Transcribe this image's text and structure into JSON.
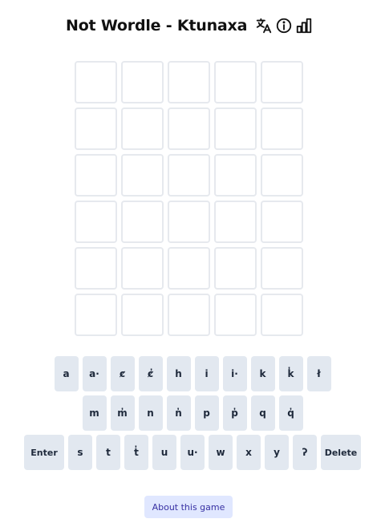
{
  "header": {
    "title": "Not Wordle - Ktunaxa",
    "icons": [
      "translate-icon",
      "info-icon",
      "stats-icon"
    ]
  },
  "board": {
    "rows": 6,
    "columns": 5,
    "letters": [
      [
        "",
        "",
        "",
        "",
        ""
      ],
      [
        "",
        "",
        "",
        "",
        ""
      ],
      [
        "",
        "",
        "",
        "",
        ""
      ],
      [
        "",
        "",
        "",
        "",
        ""
      ],
      [
        "",
        "",
        "",
        "",
        ""
      ],
      [
        "",
        "",
        "",
        "",
        ""
      ]
    ]
  },
  "keyboard": {
    "row1": [
      "a",
      "a·",
      "ȼ",
      "ȼ̓",
      "h",
      "i",
      "i·",
      "k",
      "k̓",
      "ł"
    ],
    "row2": [
      "m",
      "m̓",
      "n",
      "n̓",
      "p",
      "p̓",
      "q",
      "q̓"
    ],
    "row3": [
      "Enter",
      "s",
      "t",
      "t̓",
      "u",
      "u·",
      "w",
      "x",
      "y",
      "ʔ",
      "Delete"
    ]
  },
  "footer": {
    "about_label": "About this game"
  },
  "colors": {
    "key_bg": "#e2e8f0",
    "tile_border": "#e6e9ee",
    "about_bg": "#e0e7ff",
    "about_text": "#3730a3"
  }
}
